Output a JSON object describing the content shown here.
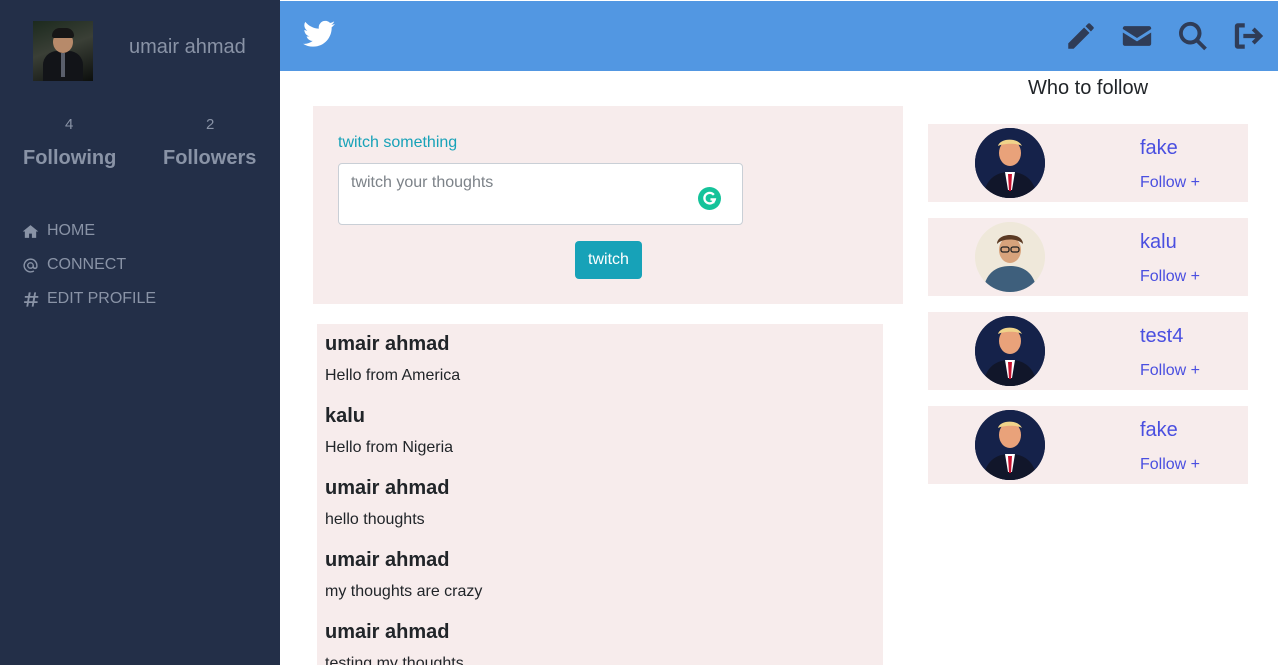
{
  "sidebar": {
    "username": "umair ahmad",
    "following_count": "4",
    "following_label": "Following",
    "followers_count": "2",
    "followers_label": "Followers",
    "nav": [
      {
        "label": "HOME",
        "icon": "home-icon"
      },
      {
        "label": "CONNECT",
        "icon": "at-icon"
      },
      {
        "label": "EDIT PROFILE",
        "icon": "hash-icon"
      }
    ]
  },
  "header": {
    "logo_icon": "twitter-bird-icon",
    "icons": [
      "pencil-icon",
      "envelope-icon",
      "search-icon",
      "logout-icon"
    ]
  },
  "compose": {
    "label": "twitch something",
    "placeholder": "twitch your thoughts",
    "button_label": "twitch"
  },
  "feed": [
    {
      "author": "umair ahmad",
      "text": "Hello from America"
    },
    {
      "author": "kalu",
      "text": "Hello from Nigeria"
    },
    {
      "author": "umair ahmad",
      "text": "hello thoughts"
    },
    {
      "author": "umair ahmad",
      "text": "my thoughts are crazy"
    },
    {
      "author": "umair ahmad",
      "text": "testing my thoughts"
    }
  ],
  "who_to_follow": {
    "title": "Who to follow",
    "users": [
      {
        "name": "fake",
        "follow_label": "Follow +"
      },
      {
        "name": "kalu",
        "follow_label": "Follow +"
      },
      {
        "name": "test4",
        "follow_label": "Follow +"
      },
      {
        "name": "fake",
        "follow_label": "Follow +"
      }
    ]
  },
  "colors": {
    "sidebar_bg": "#232f48",
    "header_bg": "#5297e2",
    "accent": "#17a2b8",
    "card_bg": "#f7ecec",
    "link": "#4a4fe0"
  }
}
